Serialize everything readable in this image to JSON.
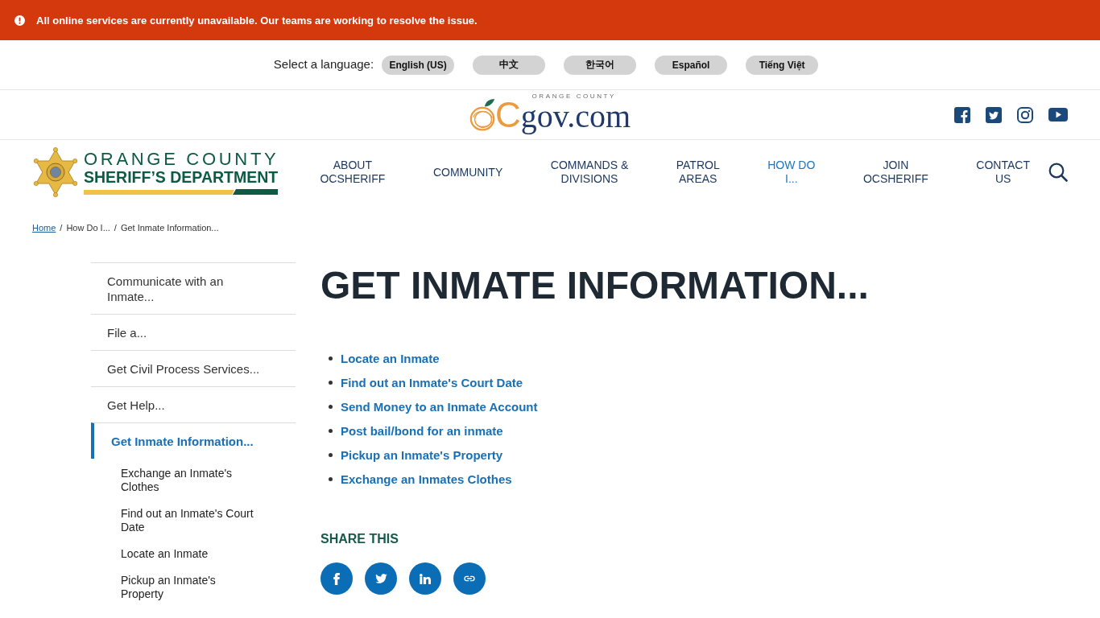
{
  "alert": {
    "message": "All online services are currently unavailable. Our teams are working to resolve the issue."
  },
  "language_bar": {
    "label": "Select a language:",
    "languages": [
      "English (US)",
      "中文",
      "한국어",
      "Español",
      "Tiếng Việt"
    ]
  },
  "ocgov_logo": {
    "tagline": "ORANGE COUNTY",
    "letter": "C",
    "wordmark": "gov.com"
  },
  "sheriff_logo": {
    "line_1": "ORANGE COUNTY",
    "line_2": "SHERIFF’S DEPARTMENT"
  },
  "nav": {
    "items": [
      {
        "label": "ABOUT\nOCSHERIFF",
        "selected": false
      },
      {
        "label": "COMMUNITY",
        "selected": false
      },
      {
        "label": "COMMANDS &\nDIVISIONS",
        "selected": false
      },
      {
        "label": "PATROL\nAREAS",
        "selected": false
      },
      {
        "label": "HOW DO\nI...",
        "selected": true
      },
      {
        "label": "JOIN\nOCSHERIFF",
        "selected": false
      },
      {
        "label": "CONTACT\nUS",
        "selected": false
      }
    ]
  },
  "breadcrumb": [
    {
      "label": "Home",
      "kind": "link"
    },
    {
      "label": "/",
      "kind": "separator"
    },
    {
      "label": "How Do I...",
      "kind": "text"
    },
    {
      "label": "/",
      "kind": "separator"
    },
    {
      "label": "Get Inmate Information...",
      "kind": "text"
    }
  ],
  "sidebar": {
    "items": [
      {
        "label": "Communicate with an\nInmate...",
        "selected": false
      },
      {
        "label": "File a...",
        "selected": false
      },
      {
        "label": "Get Civil Process Services...",
        "selected": false
      },
      {
        "label": "Get Help...",
        "selected": false
      },
      {
        "label": "Get Inmate Information...",
        "selected": true,
        "children": [
          {
            "label": "Exchange an Inmate's\nClothes",
            "selected": false
          },
          {
            "label": "Find out an Inmate's Court\nDate",
            "selected": false
          },
          {
            "label": "Locate an Inmate",
            "selected": false
          },
          {
            "label": "Pickup an Inmate's\nProperty",
            "selected": false
          }
        ]
      }
    ]
  },
  "page_title": "GET INMATE INFORMATION...",
  "links": [
    "Locate an Inmate",
    "Find out an Inmate's Court Date",
    "Send Money to an Inmate Account",
    "Post bail/bond for an inmate",
    "Pickup an Inmate's Property",
    "Exchange an Inmates Clothes"
  ],
  "share": {
    "heading": "SHARE THIS"
  }
}
